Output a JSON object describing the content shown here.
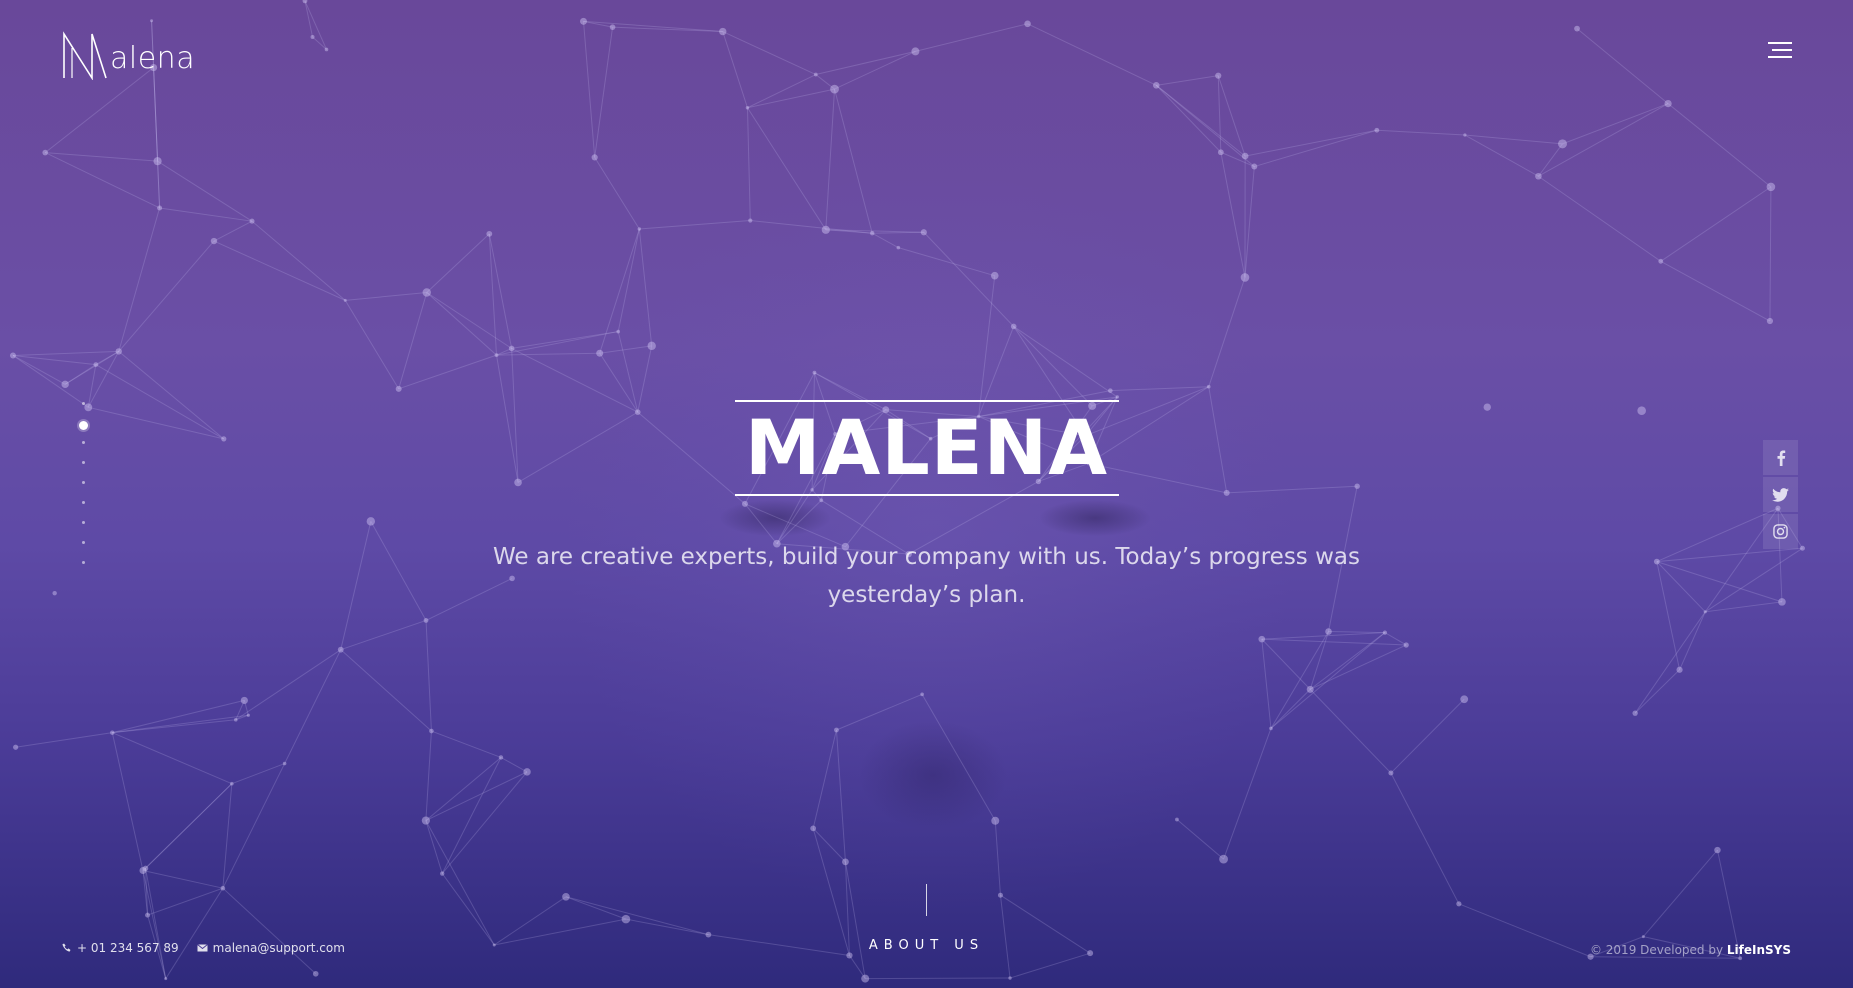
{
  "brand": {
    "logo_text": "alena"
  },
  "header": {
    "menu_icon": "hamburger-menu-icon"
  },
  "hero": {
    "title": "MALENA",
    "tagline": "We are creative experts, build your company with us. Today’s progress was yesterday’s plan."
  },
  "section_nav": {
    "active_index": 1,
    "count": 9
  },
  "social": [
    {
      "name": "facebook",
      "icon": "facebook-icon"
    },
    {
      "name": "twitter",
      "icon": "twitter-icon"
    },
    {
      "name": "instagram",
      "icon": "instagram-icon"
    }
  ],
  "scroll": {
    "label": "ABOUT US"
  },
  "footer": {
    "phone": "+ 01 234 567 89",
    "email": "malena@support.com",
    "copyright_prefix": "© 2019 Developed by ",
    "developer": "LifeInSYS"
  },
  "colors": {
    "bg_top": "#69489a",
    "bg_mid": "#5e4aa6",
    "bg_bottom": "#2f2a7c",
    "text": "#ffffff"
  }
}
